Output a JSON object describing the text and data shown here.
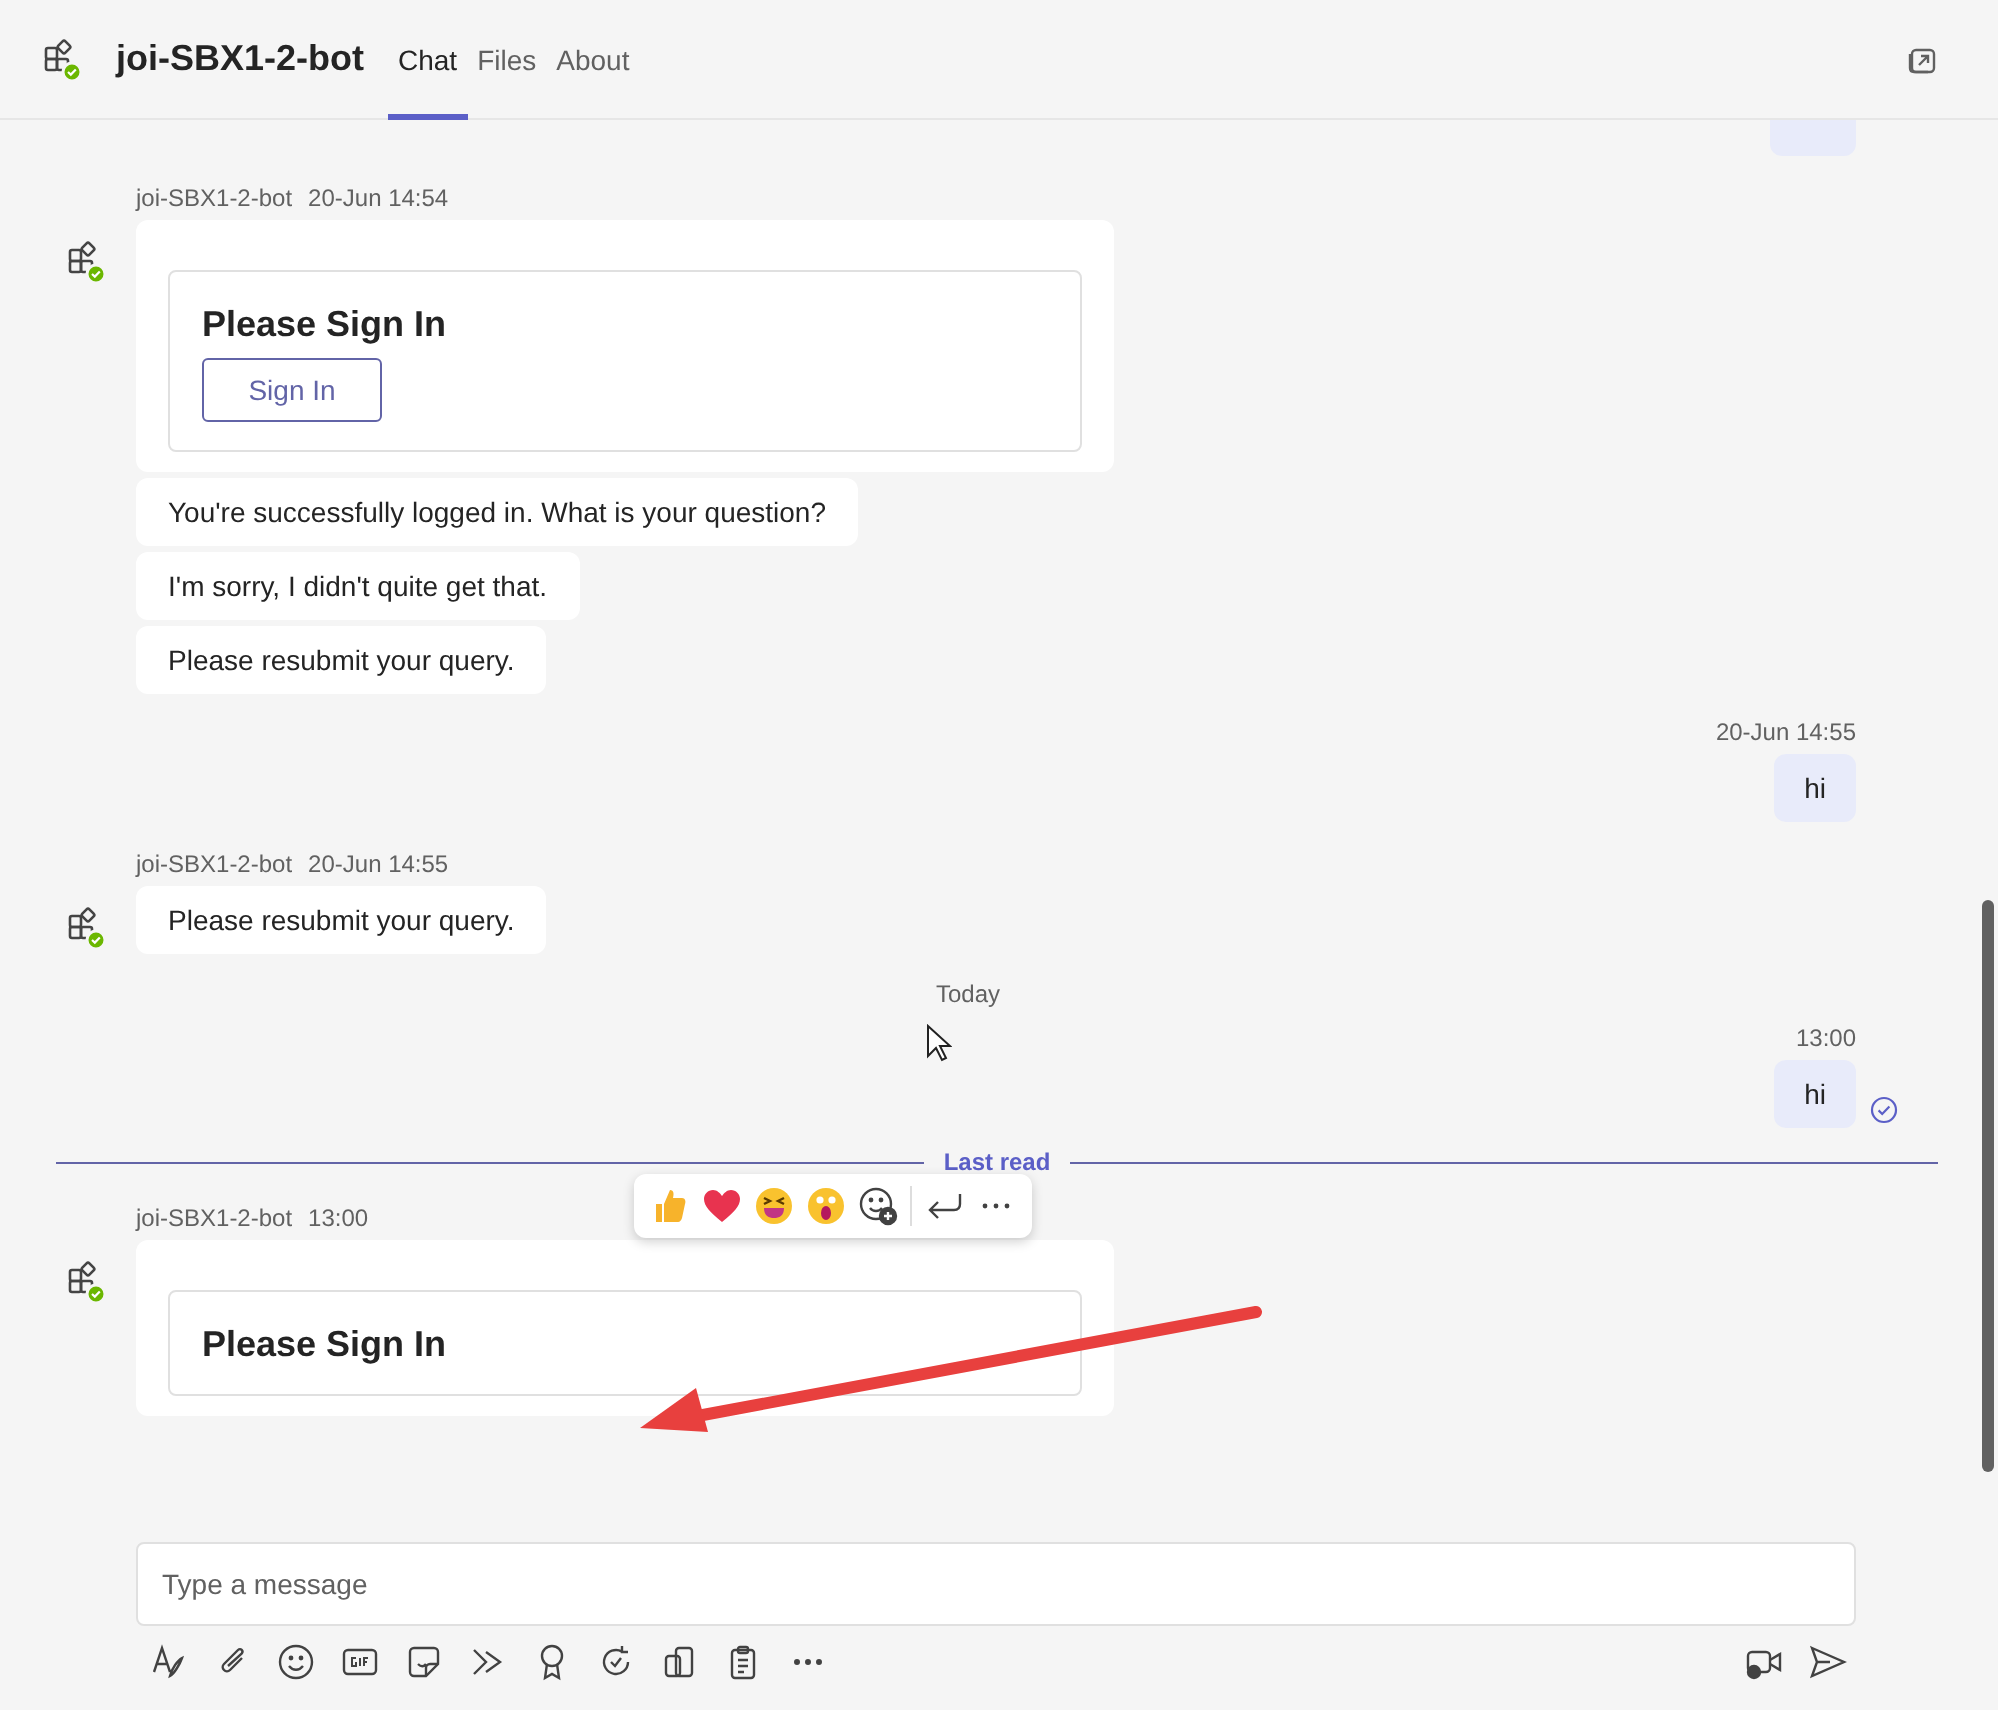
{
  "header": {
    "title": "joi-SBX1-2-bot",
    "tabs": [
      {
        "label": "Chat",
        "selected": true
      },
      {
        "label": "Files",
        "selected": false
      },
      {
        "label": "About",
        "selected": false
      }
    ]
  },
  "messages": [
    {
      "kind": "clipped"
    },
    {
      "kind": "bot",
      "sender": "joi-SBX1-2-bot",
      "time": "20-Jun 14:54",
      "bubbles": [
        {
          "kind": "card",
          "title": "Please Sign In",
          "button": "Sign In"
        },
        {
          "kind": "text",
          "text": "You're successfully logged in. What is your question?"
        },
        {
          "kind": "text",
          "text": "I'm sorry, I didn't quite get that."
        },
        {
          "kind": "text",
          "text": "Please resubmit your query."
        }
      ]
    },
    {
      "kind": "me",
      "time": "20-Jun 14:55",
      "text": "hi",
      "read": false
    },
    {
      "kind": "bot",
      "sender": "joi-SBX1-2-bot",
      "time": "20-Jun 14:55",
      "bubbles": [
        {
          "kind": "text",
          "text": "Please resubmit your query."
        }
      ]
    },
    {
      "kind": "date",
      "text": "Today"
    },
    {
      "kind": "me",
      "time": "13:00",
      "text": "hi",
      "read": true
    },
    {
      "kind": "last_read",
      "text": "Last read"
    },
    {
      "kind": "bot",
      "sender": "joi-SBX1-2-bot",
      "time": "13:00",
      "reactions": true,
      "bubbles": [
        {
          "kind": "card",
          "title": "Please Sign In"
        }
      ]
    }
  ],
  "composer": {
    "placeholder": "Type a message"
  }
}
